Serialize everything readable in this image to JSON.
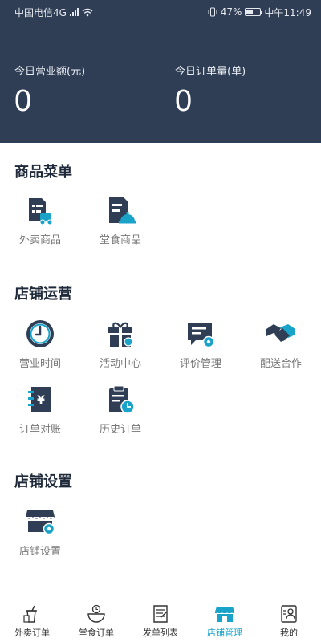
{
  "status": {
    "carrier": "中国电信4G",
    "network": "4G",
    "battery": "47%",
    "battery_level": 0.47,
    "time": "中午11:49"
  },
  "stats": [
    {
      "label": "今日营业额(元)",
      "value": "0"
    },
    {
      "label": "今日订单量(单)",
      "value": "0"
    }
  ],
  "colors": {
    "header": "#2f3e54",
    "accent": "#1aa3c8",
    "icon_dark": "#2f3e54"
  },
  "sections": {
    "menu": {
      "title": "商品菜单",
      "items": [
        {
          "label": "外卖商品",
          "icon": "delivery-goods-icon"
        },
        {
          "label": "堂食商品",
          "icon": "dine-in-goods-icon"
        }
      ]
    },
    "operation": {
      "title": "店铺运营",
      "items": [
        {
          "label": "营业时间",
          "icon": "clock-icon"
        },
        {
          "label": "活动中心",
          "icon": "gift-icon"
        },
        {
          "label": "评价管理",
          "icon": "review-icon"
        },
        {
          "label": "配送合作",
          "icon": "handshake-icon"
        },
        {
          "label": "订单对账",
          "icon": "reconcile-icon"
        },
        {
          "label": "历史订单",
          "icon": "history-icon"
        }
      ]
    },
    "settings": {
      "title": "店铺设置",
      "items": [
        {
          "label": "店铺设置",
          "icon": "shop-settings-icon"
        }
      ]
    }
  },
  "tabbar": [
    {
      "label": "外卖订单",
      "icon": "takeout-order-icon"
    },
    {
      "label": "堂食订单",
      "icon": "dine-order-icon"
    },
    {
      "label": "发单列表",
      "icon": "dispatch-list-icon"
    },
    {
      "label": "店铺管理",
      "icon": "shop-manage-icon",
      "active": true
    },
    {
      "label": "我的",
      "icon": "profile-icon"
    }
  ]
}
